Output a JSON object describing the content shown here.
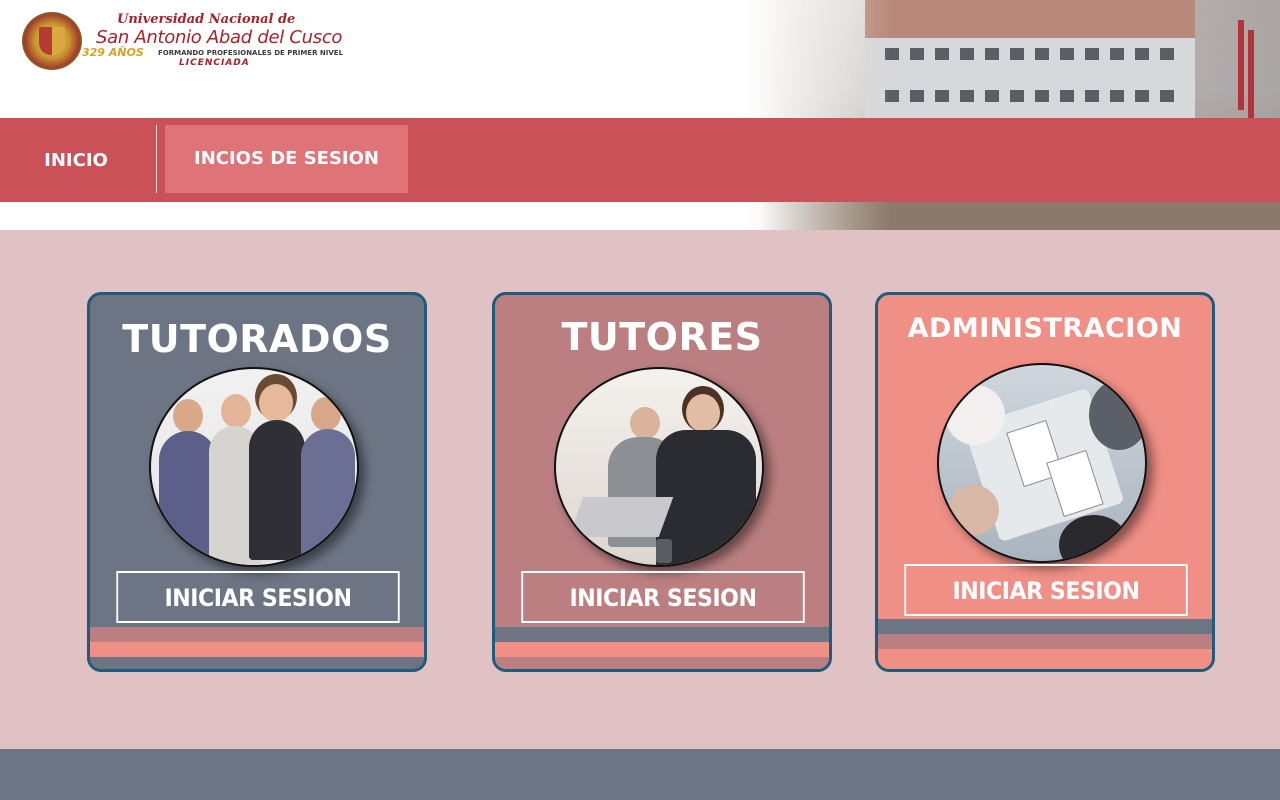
{
  "header": {
    "logo": {
      "line1": "Universidad Nacional de",
      "line2": "San Antonio Abad del Cusco",
      "years": "329 AÑOS",
      "line3": "FORMANDO PROFESIONALES DE PRIMER NIVEL",
      "line4": "LICENCIADA"
    }
  },
  "nav": {
    "items": [
      {
        "label": "INICIO",
        "active": false
      },
      {
        "label": "INCIOS DE SESION",
        "active": true
      }
    ]
  },
  "cards": [
    {
      "title": "TUTORADOS",
      "button": "INICIAR SESION",
      "image": "students-photo"
    },
    {
      "title": "TUTORES",
      "button": "INICIAR SESION",
      "image": "tutors-photo"
    },
    {
      "title": "ADMINISTRACION",
      "button": "INICIAR SESION",
      "image": "administration-meeting-photo"
    }
  ],
  "colors": {
    "nav_bg": "#c95157",
    "nav_active": "#df7478",
    "main_bg": "#e0c2c4",
    "card_slate": "#6d7584",
    "card_rose": "#bb7f81",
    "card_salmon": "#f08f86",
    "card_border": "#1f5b7a",
    "footer_bg": "#6d7584"
  }
}
